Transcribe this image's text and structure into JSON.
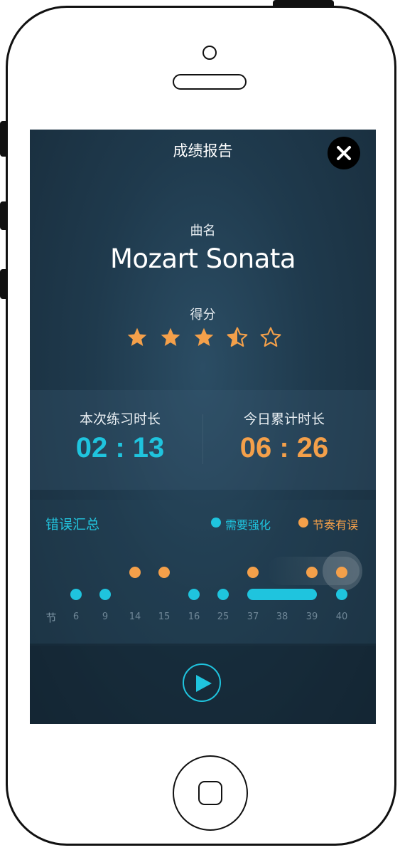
{
  "header": {
    "title": "成绩报告"
  },
  "song": {
    "label": "曲名",
    "name": "Mozart Sonata"
  },
  "score": {
    "label": "得分",
    "stars": 3.5,
    "max_stars": 5,
    "star_color": "#f4a04a"
  },
  "stats": {
    "session": {
      "label": "本次练习时长",
      "value": "02 : 13",
      "color": "#1fc4de"
    },
    "today": {
      "label": "今日累计时长",
      "value": "06 : 26",
      "color": "#f4a04a"
    }
  },
  "errors": {
    "title": "错误汇总",
    "legend": [
      {
        "label": "需要强化",
        "color": "#1fc4de"
      },
      {
        "label": "节奏有误",
        "color": "#f4a04a"
      }
    ],
    "axis_label": "节",
    "measures": [
      "6",
      "9",
      "14",
      "15",
      "16",
      "25",
      "37",
      "38",
      "39",
      "40"
    ]
  },
  "icons": {
    "close": "close-icon",
    "play": "play-icon",
    "star": "star-icon"
  }
}
